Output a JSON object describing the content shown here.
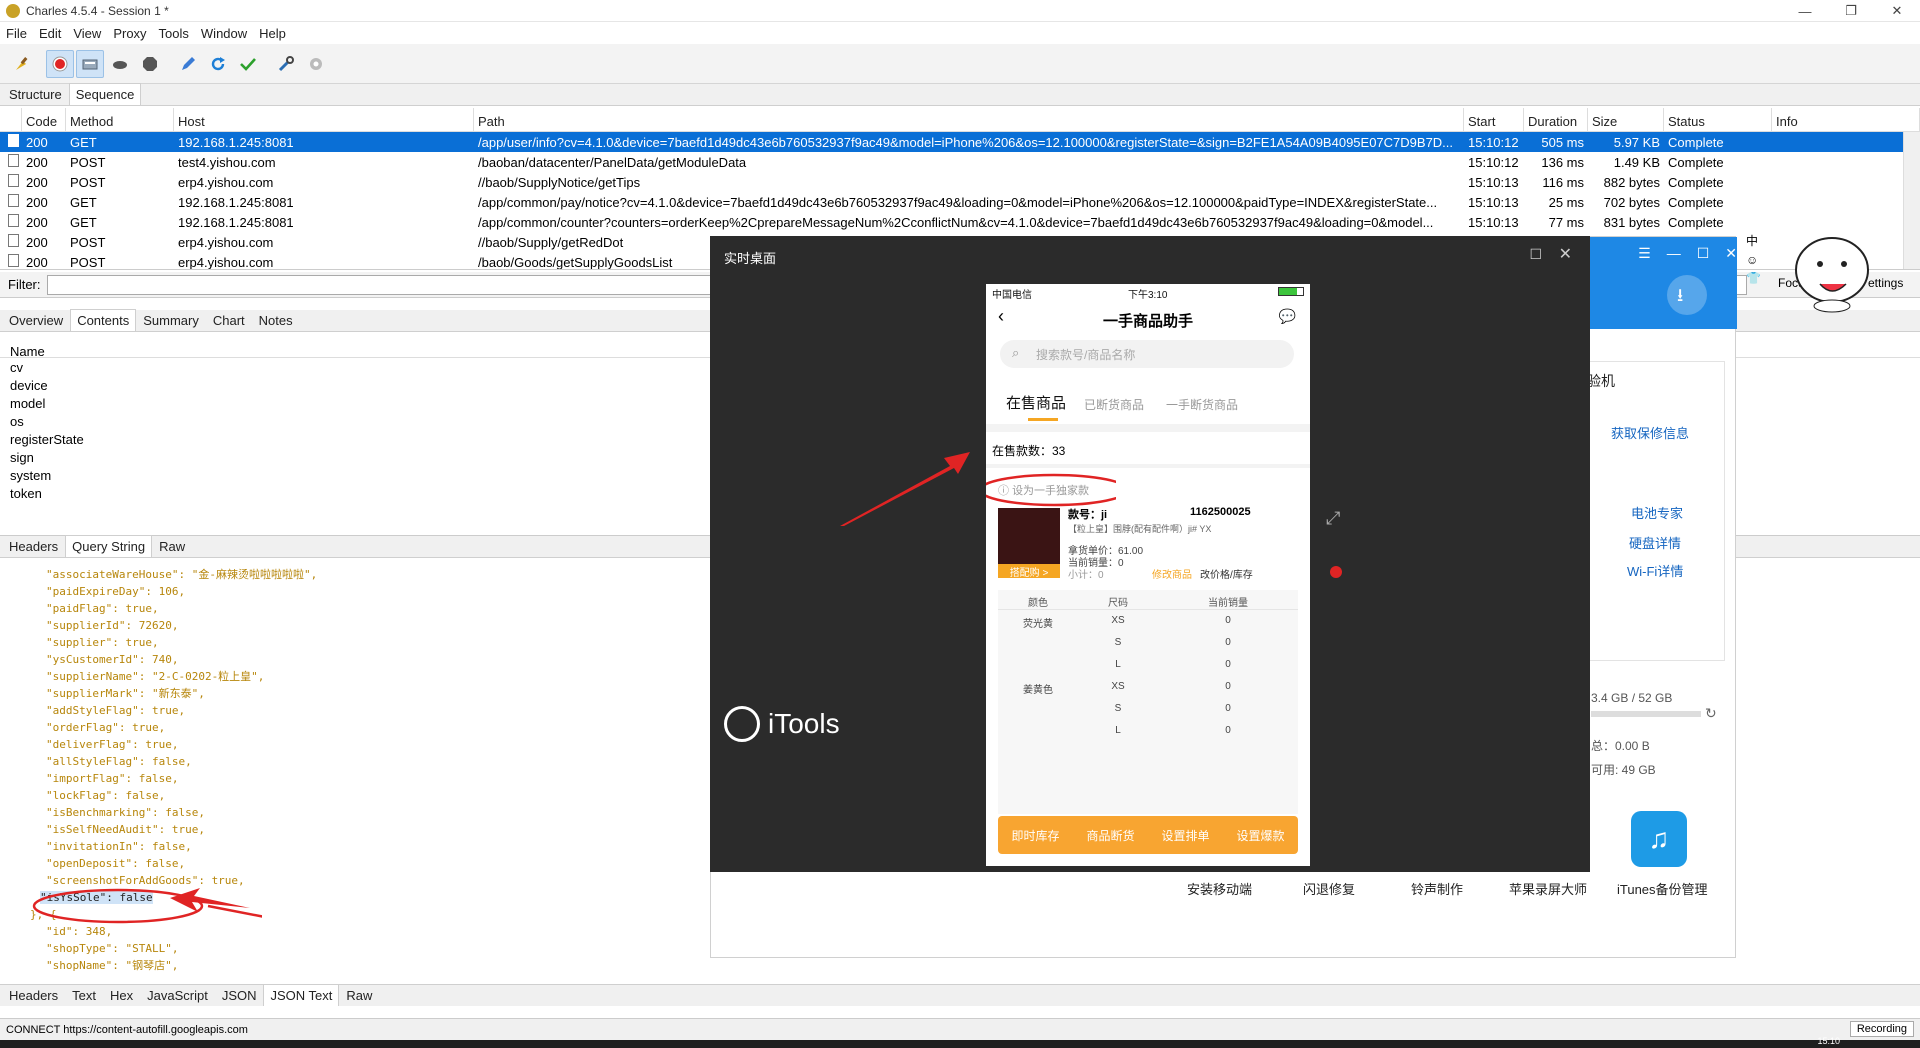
{
  "window": {
    "title": "Charles 4.5.4 - Session 1 *",
    "min": "—",
    "max": "❐",
    "close": "✕"
  },
  "menu": [
    "File",
    "Edit",
    "View",
    "Proxy",
    "Tools",
    "Window",
    "Help"
  ],
  "view_tabs": [
    "Structure",
    "Sequence"
  ],
  "columns": [
    "Code",
    "Method",
    "Host",
    "Path",
    "Start",
    "Duration",
    "Size",
    "Status",
    "Info"
  ],
  "rows": [
    {
      "code": "200",
      "method": "GET",
      "host": "192.168.1.245:8081",
      "path": "/app/user/info?cv=4.1.0&device=7baefd1d49dc43e6b760532937f9ac49&model=iPhone%206&os=12.100000&registerState=&sign=B2FE1A54A09B4095E07C7D9B7D...",
      "start": "15:10:12",
      "duration": "505 ms",
      "size": "5.97 KB",
      "status": "Complete"
    },
    {
      "code": "200",
      "method": "POST",
      "host": "test4.yishou.com",
      "path": "/baoban/datacenter/PanelData/getModuleData",
      "start": "15:10:12",
      "duration": "136 ms",
      "size": "1.49 KB",
      "status": "Complete"
    },
    {
      "code": "200",
      "method": "POST",
      "host": "erp4.yishou.com",
      "path": "//baob/SupplyNotice/getTips",
      "start": "15:10:13",
      "duration": "116 ms",
      "size": "882 bytes",
      "status": "Complete"
    },
    {
      "code": "200",
      "method": "GET",
      "host": "192.168.1.245:8081",
      "path": "/app/common/pay/notice?cv=4.1.0&device=7baefd1d49dc43e6b760532937f9ac49&loading=0&model=iPhone%206&os=12.100000&paidType=INDEX&registerState...",
      "start": "15:10:13",
      "duration": "25 ms",
      "size": "702 bytes",
      "status": "Complete"
    },
    {
      "code": "200",
      "method": "GET",
      "host": "192.168.1.245:8081",
      "path": "/app/common/counter?counters=orderKeep%2CprepareMessageNum%2CconflictNum&cv=4.1.0&device=7baefd1d49dc43e6b760532937f9ac49&loading=0&model...",
      "start": "15:10:13",
      "duration": "77 ms",
      "size": "831 bytes",
      "status": "Complete"
    },
    {
      "code": "200",
      "method": "POST",
      "host": "erp4.yishou.com",
      "path": "//baob/Supply/getRedDot",
      "start": "",
      "duration": "",
      "size": "",
      "status": ""
    },
    {
      "code": "200",
      "method": "POST",
      "host": "erp4.yishou.com",
      "path": "/baob/Goods/getSupplyGoodsList",
      "start": "",
      "duration": "",
      "size": "",
      "status": ""
    }
  ],
  "filter_label": "Filter:",
  "detail_tabs": [
    "Overview",
    "Contents",
    "Summary",
    "Chart",
    "Notes"
  ],
  "query": {
    "header": "Name",
    "params": [
      "cv",
      "device",
      "model",
      "os",
      "registerState",
      "sign",
      "system",
      "token"
    ]
  },
  "req_tabs": [
    "Headers",
    "Query String",
    "Raw"
  ],
  "json_lines": [
    "\"associateWareHouse\": \"金-麻辣烫啦啦啦啦啦\",",
    "\"paidExpireDay\": 106,",
    "\"paidFlag\": true,",
    "\"supplierId\": 72620,",
    "\"supplier\": true,",
    "\"ysCustomerId\": 740,",
    "\"supplierName\": \"2-C-0202-粒上皇\",",
    "\"supplierMark\": \"新东泰\",",
    "\"addStyleFlag\": true,",
    "\"orderFlag\": true,",
    "\"deliverFlag\": true,",
    "\"allStyleFlag\": false,",
    "\"importFlag\": false,",
    "\"lockFlag\": false,",
    "\"isBenchmarking\": false,",
    "\"isSelfNeedAudit\": true,",
    "\"invitationIn\": false,",
    "\"openDeposit\": false,",
    "\"screenshotForAddGoods\": true,",
    "\"isYsSole\": false",
    "}, {",
    "\"id\": 348,",
    "\"shopType\": \"STALL\",",
    "\"shopName\": \"钢琴店\","
  ],
  "resp_tabs": [
    "Headers",
    "Text",
    "Hex",
    "JavaScript",
    "JSON",
    "JSON Text",
    "Raw"
  ],
  "status": {
    "text": "CONNECT https://content-autofill.googleapis.com",
    "recording": "Recording",
    "clock": "15:10"
  },
  "realtime": {
    "title": "实时桌面",
    "phone": {
      "carrier": "中国电信",
      "time": "下午3:10",
      "nav_title": "一手商品助手",
      "search_placeholder": "搜索款号/商品名称",
      "tabs": [
        "在售商品",
        "已断货商品",
        "一手断货商品"
      ],
      "count_label": "在售款数：33",
      "set_sole": "设为一手独家款",
      "product": {
        "code_label": "款号：ji",
        "code_num": "1162500025",
        "desc": "【粒上皇】围脖(配有配件啊）ji# YX",
        "price": "拿货单价：61.00",
        "sales": "当前销量：0",
        "subtotal": "小计：0",
        "match": "搭配购 >",
        "edit": "修改商品",
        "stock": "改价格/库存"
      },
      "table_head": [
        "颜色",
        "尺码",
        "当前销量"
      ],
      "table_rows": [
        [
          "荧光黄",
          "XS",
          "0"
        ],
        [
          "",
          "S",
          "0"
        ],
        [
          "",
          "L",
          "0"
        ],
        [
          "姜黄色",
          "XS",
          "0"
        ],
        [
          "",
          "S",
          "0"
        ],
        [
          "",
          "L",
          "0"
        ]
      ],
      "bottom_buttons": [
        "即时库存",
        "商品断货",
        "设置排单",
        "设置爆款"
      ]
    },
    "logo": "iTools"
  },
  "itools": {
    "side_partial": "验机",
    "links": [
      "获取保修信息",
      "电池专家",
      "硬盘详情",
      "Wi-Fi详情"
    ],
    "disk": "3.4 GB / 52 GB",
    "free": "总：0.00 B",
    "avail": "可用: 49 GB",
    "tools": [
      "安装移动端",
      "闪退修复",
      "铃声制作",
      "苹果录屏大师",
      "iTunes备份管理"
    ]
  },
  "float_chars": [
    "中",
    "☺",
    "👕"
  ],
  "settings_partial": [
    "Focu",
    "ettings"
  ]
}
